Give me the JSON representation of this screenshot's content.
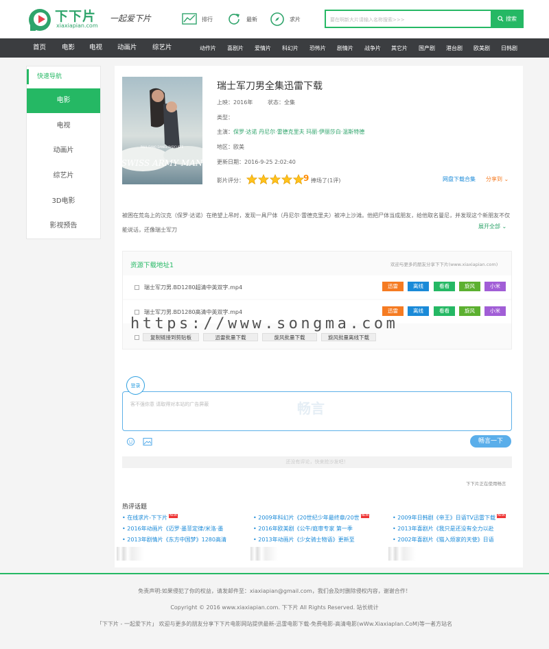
{
  "header": {
    "logo_cn": "下下片",
    "logo_en": "xiaxiapian.com",
    "slogan": "一起爱下片",
    "links": [
      {
        "label": "排行",
        "icon": "chart-icon"
      },
      {
        "label": "最新",
        "icon": "refresh-icon"
      },
      {
        "label": "求片",
        "icon": "compass-icon"
      }
    ],
    "search_placeholder": "要在啊新大片请输入名称搜索>>>",
    "search_button": "搜索"
  },
  "nav": {
    "main": [
      "首页",
      "电影",
      "电视",
      "动画片",
      "综艺片"
    ],
    "sub": [
      "动作片",
      "喜剧片",
      "爱情片",
      "科幻片",
      "恐怖片",
      "剧情片",
      "战争片",
      "其它片",
      "国产剧",
      "港台剧",
      "欧美剧",
      "日韩剧"
    ]
  },
  "sidebar": {
    "title": "快速导航",
    "items": [
      "电影",
      "电视",
      "动画片",
      "综艺片",
      "3D电影",
      "影视预告"
    ]
  },
  "movie": {
    "poster_title": "SWISS ARMY MAN",
    "poster_names": "PAUL DANO   DANIEL RADCLIFFE",
    "title": "瑞士军刀男全集迅雷下载",
    "release_label": "上映：",
    "release": "2016年",
    "status_label": "状态：",
    "status": "全集",
    "genre_label": "类型：",
    "cast_label": "主演：",
    "cast": [
      "保罗·达诺",
      "丹尼尔·雷德克里夫",
      "玛丽·伊丽莎白·温斯特德"
    ],
    "region_label": "地区：",
    "region": "欧美",
    "updated_label": "更新日期：",
    "updated": "2016-9-25 2:02:40",
    "rating_label": "影片评分：",
    "rating_stars": 5,
    "rating_score": "9",
    "rating_count": "捧场了(1评)",
    "dl_collection": "网盘下载合集",
    "share": "分享到",
    "description": "被困在荒岛上的汉克（保罗·达诺）在绝望上吊时，发现一具尸体（丹尼尔·雷德克里夫）被冲上沙滩。他把尸体当成朋友，给他取名曼尼，并发现这个新朋友不仅能说话，还像瑞士军刀",
    "expand": "展开全部"
  },
  "downloads": {
    "title": "资源下载地址1",
    "note": "欢迎与更多的朋友分享下下片(www.xiaxiapian.com)",
    "files": [
      "瑞士军刀男.BD1280超清中英双字.mp4",
      "瑞士军刀男.BD1280高清中英双字.mp4"
    ],
    "buttons": [
      {
        "label": "迅雷",
        "color": "#f57b22"
      },
      {
        "label": "离线",
        "color": "#1a8ad8"
      },
      {
        "label": "看看",
        "color": "#25b864"
      },
      {
        "label": "旋风",
        "color": "#5cb030"
      },
      {
        "label": "小米",
        "color": "#a15ed6"
      }
    ],
    "batch": [
      "复制链接到剪贴板",
      "迅雷批量下载",
      "旋风批量下载",
      "旋风批量离线下载"
    ]
  },
  "watermark": "https://www.songma.com",
  "comments": {
    "login": "登录",
    "placeholder": "客不强你意 请取得对本站的广告屏蔽",
    "box_watermark": "畅言",
    "submit": "畅言一下",
    "load_more": "还没有评论，快来抢沙发吧！",
    "powered": "下下片正在使用畅言"
  },
  "hot": {
    "title": "热评话题",
    "col1": [
      "在线求片-下下片",
      "2016年动画片《迈罗·墨菲定律/米洛·墨",
      "2013年剧情片《东方中国梦》1280高清"
    ],
    "col2": [
      "2009年科幻片《20世纪少年最终章/20世",
      "2016年欧美剧《公牛/庭审专家 第一季",
      "2013年动画片《少女骑士物语》更新至"
    ],
    "col3": [
      "2009年日韩剧《帝王》日语TV迅雷下载",
      "2013年喜剧片《我只是还没有全力以赴",
      "2002年喜剧片《猫入烦家的天使》日语"
    ],
    "new_badge": "NEW"
  },
  "footer": {
    "line1": "免责声明:如果侵犯了你的权益，请发邮件至：xiaxiapian@gmail.com，我们会及时删除侵权内容，谢谢合作！",
    "line2": "Copyright © 2016 www.xiaxiapian.com. 下下片 All Rights Reserved. 站长统计",
    "line3": "「下下片 - 一起爱下片」 欢迎与更多的朋友分享下下片电影网站提供最新-迅雷电影下载-免费电影-高清电影(wWw.XiaxiapIan.CoM)等一者方站名"
  },
  "colors": {
    "accent": "#25b864",
    "nav_bg": "#3b3d40",
    "link_blue": "#1a8ad8",
    "orange": "#f57b22"
  }
}
